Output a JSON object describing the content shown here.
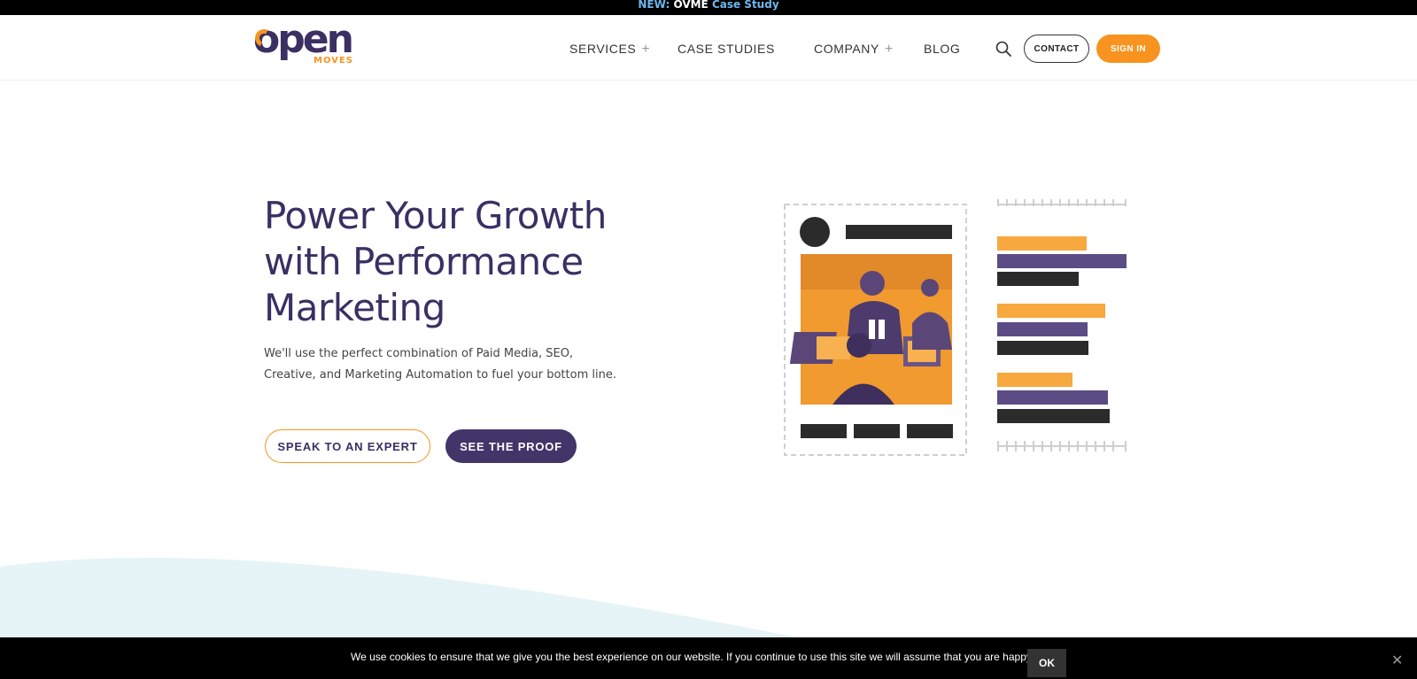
{
  "announcement": {
    "new_label": "NEW:",
    "highlight": "OVME",
    "link_text": "Case Study"
  },
  "brand": {
    "logo_main": "open",
    "logo_sub": "MOVES",
    "colors": {
      "primary": "#3b2f63",
      "accent": "#f7931e",
      "button_dark": "#433569"
    }
  },
  "nav": {
    "items": [
      {
        "label": "SERVICES",
        "has_plus": true
      },
      {
        "label": "CASE STUDIES",
        "has_plus": false
      },
      {
        "label": "COMPANY",
        "has_plus": true
      },
      {
        "label": "BLOG",
        "has_plus": false
      }
    ],
    "plus_symbol": "+",
    "search_icon": "search-icon",
    "contact_label": "CONTACT",
    "signin_label": "SIGN IN"
  },
  "hero": {
    "title_line1": "Power Your Growth",
    "title_line2": "with Performance",
    "title_line3": "Marketing",
    "subtitle_line1": "We'll use the perfect combination of Paid Media, SEO,",
    "subtitle_line2": "Creative, and Marketing Automation to fuel your bottom line.",
    "cta_primary": "SPEAK TO AN EXPERT",
    "cta_secondary": "SEE THE PROOF"
  },
  "illustration": {
    "pause_icon": "pause-icon"
  },
  "cookie": {
    "message": "We use cookies to ensure that we give you the best experience on our website. If you continue to use this site we will assume that you are happy with it.",
    "ok_label": "OK",
    "close_symbol": "✕"
  }
}
